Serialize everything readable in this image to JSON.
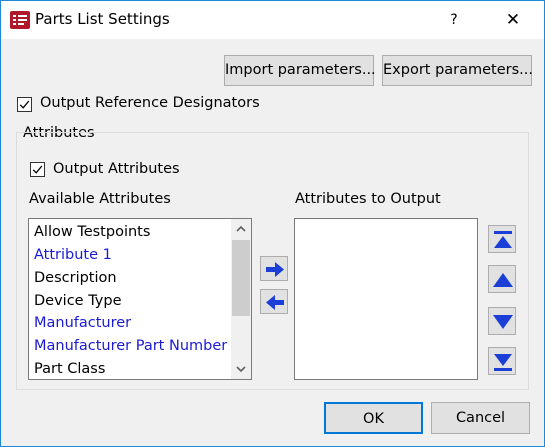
{
  "window": {
    "title": "Parts List Settings",
    "help_glyph": "?",
    "close_glyph": "✕"
  },
  "buttons": {
    "import": "Import parameters...",
    "export": "Export parameters...",
    "ok": "OK",
    "cancel": "Cancel"
  },
  "checkboxes": {
    "output_ref_designators": {
      "label": "Output Reference Designators",
      "checked": true
    },
    "output_attributes": {
      "label": "Output Attributes",
      "checked": true
    }
  },
  "attributes_group": {
    "title": "Attributes",
    "available_label": "Available Attributes",
    "output_label": "Attributes to Output",
    "available_items": [
      {
        "label": "Allow Testpoints",
        "color": "#000000"
      },
      {
        "label": "Attribute 1",
        "color": "#1a1ad6"
      },
      {
        "label": "Description",
        "color": "#000000"
      },
      {
        "label": "Device Type",
        "color": "#000000"
      },
      {
        "label": "Manufacturer",
        "color": "#1a1ad6"
      },
      {
        "label": "Manufacturer Part Number",
        "color": "#1a1ad6"
      },
      {
        "label": "Part Class",
        "color": "#000000"
      }
    ],
    "output_items": []
  },
  "icons": {
    "move_right": "arrow-right-icon",
    "move_left": "arrow-left-icon",
    "move_top": "move-to-top-icon",
    "move_up": "move-up-icon",
    "move_down": "move-down-icon",
    "move_bottom": "move-to-bottom-icon"
  },
  "colors": {
    "accent_border": "#1e88d6",
    "link_item": "#1a1ad6",
    "arrow_blue": "#1b3fd6"
  }
}
